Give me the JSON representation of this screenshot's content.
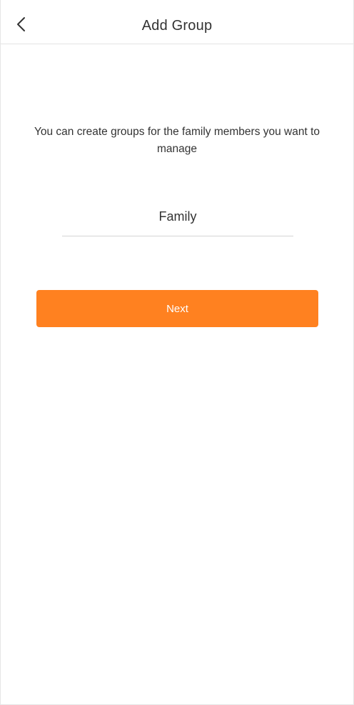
{
  "header": {
    "title": "Add Group",
    "back_icon": "chevron-left-icon"
  },
  "main": {
    "description": "You can create groups for the family members you want to manage",
    "group_name": {
      "value": "Family",
      "placeholder": ""
    },
    "next_label": "Next"
  },
  "colors": {
    "accent": "#ff8120",
    "text": "#333333",
    "divider": "#e4e4e4",
    "background": "#ffffff"
  }
}
